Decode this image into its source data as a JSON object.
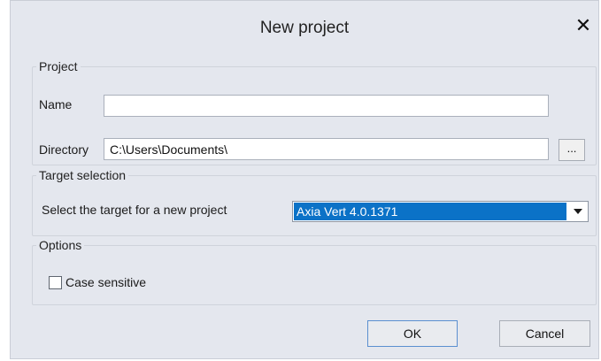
{
  "dialog": {
    "title": "New project",
    "close_glyph": "✕"
  },
  "project_group": {
    "legend": "Project",
    "name_label": "Name",
    "name_value": "",
    "directory_label": "Directory",
    "directory_value": "C:\\Users\\Documents\\",
    "browse_label": "..."
  },
  "target_group": {
    "legend": "Target selection",
    "prompt_label": "Select the target for a new project",
    "selected_target": "Axia Vert 4.0.1371"
  },
  "options_group": {
    "legend": "Options",
    "case_sensitive_label": "Case sensitive",
    "case_sensitive_checked": false
  },
  "buttons": {
    "ok_label": "OK",
    "cancel_label": "Cancel"
  },
  "colors": {
    "dialog_background": "#e4e7ee",
    "selection_highlight": "#0b72c7"
  },
  "icons": {
    "close": "close-icon",
    "dropdown": "chevron-down-icon"
  }
}
